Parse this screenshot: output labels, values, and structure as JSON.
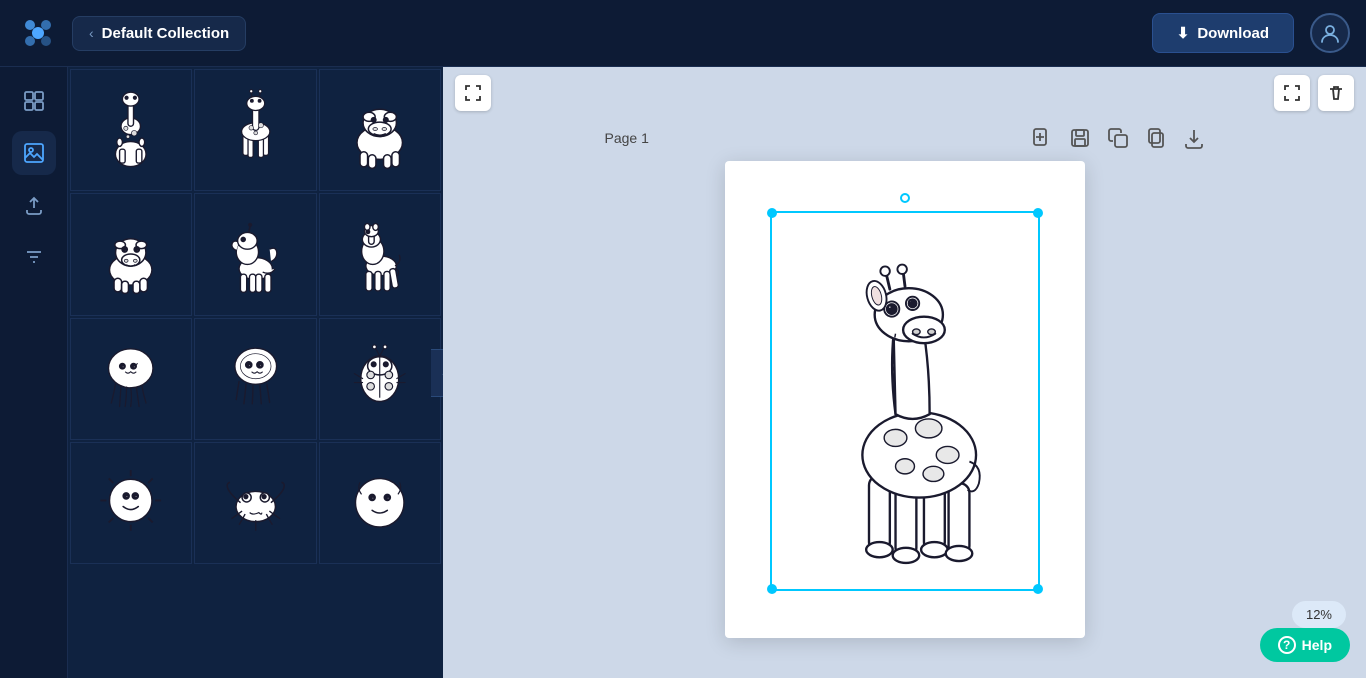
{
  "app": {
    "logo_label": "App Logo"
  },
  "header": {
    "breadcrumb_back": "‹",
    "collection_name": "Default Collection",
    "download_label": "Download",
    "download_icon": "⬇",
    "user_icon": "👤"
  },
  "sidebar": {
    "items": [
      {
        "id": "grid",
        "icon": "▦",
        "label": "Grid View",
        "active": false
      },
      {
        "id": "images",
        "icon": "🖼",
        "label": "Images",
        "active": true
      },
      {
        "id": "upload",
        "icon": "☁",
        "label": "Upload",
        "active": false
      },
      {
        "id": "settings",
        "icon": "⚙",
        "label": "Filters",
        "active": false
      }
    ]
  },
  "asset_panel": {
    "assets": [
      {
        "id": 1,
        "label": "Giraffe 1",
        "type": "giraffe-sitting"
      },
      {
        "id": 2,
        "label": "Giraffe 2",
        "type": "giraffe-standing"
      },
      {
        "id": 3,
        "label": "Hippo",
        "type": "hippo"
      },
      {
        "id": 4,
        "label": "Hippo 2",
        "type": "hippo2"
      },
      {
        "id": 5,
        "label": "Unicorn",
        "type": "unicorn"
      },
      {
        "id": 6,
        "label": "Horse",
        "type": "horse"
      },
      {
        "id": 7,
        "label": "Jellyfish 1",
        "type": "jellyfish1"
      },
      {
        "id": 8,
        "label": "Jellyfish 2",
        "type": "jellyfish2"
      },
      {
        "id": 9,
        "label": "Ladybug",
        "type": "ladybug"
      },
      {
        "id": 10,
        "label": "Sun",
        "type": "sun"
      },
      {
        "id": 11,
        "label": "Crab",
        "type": "crab"
      },
      {
        "id": 12,
        "label": "Unknown",
        "type": "unknown"
      }
    ]
  },
  "canvas": {
    "page_label": "Page 1",
    "zoom_percent": "12%",
    "help_label": "Help",
    "help_icon": "?"
  }
}
